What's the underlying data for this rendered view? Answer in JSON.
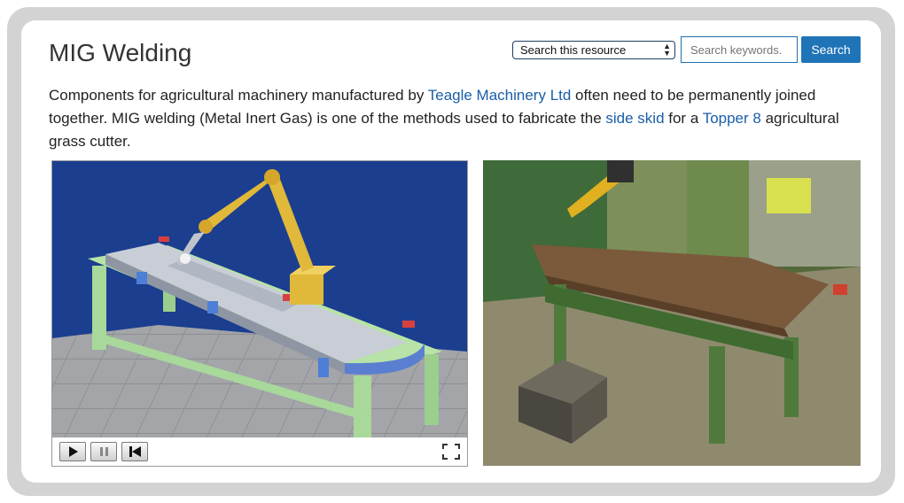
{
  "page": {
    "title": "MIG Welding"
  },
  "search": {
    "scope_selected": "Search this resource",
    "input_placeholder": "Search keywords.",
    "button_label": "Search"
  },
  "intro": {
    "t1": "Components for agricultural machinery manufactured by ",
    "link_teagle": "Teagle Machinery Ltd",
    "t2": " often need to be permanently joined together. MIG welding (Metal Inert Gas) is one of the methods used to fabricate the ",
    "link_side_skid": "side skid",
    "t3": " for a ",
    "link_topper": "Topper 8",
    "t4": " agricultural grass cutter."
  },
  "animation": {
    "controls": [
      "play",
      "pause",
      "rewind",
      "fullscreen"
    ]
  },
  "icons": {
    "play": "play-icon",
    "pause": "pause-icon",
    "rewind": "skip-back-icon",
    "fullscreen": "fullscreen-icon",
    "select_arrows": "updown-arrows-icon"
  },
  "colors": {
    "accent": "#1f73b7",
    "link": "#1a5ea8",
    "frame": "#d3d3d3",
    "animation_bg": "#1b3e8f",
    "robot_arm": "#e0b83a",
    "bench": "#a8d89a"
  }
}
